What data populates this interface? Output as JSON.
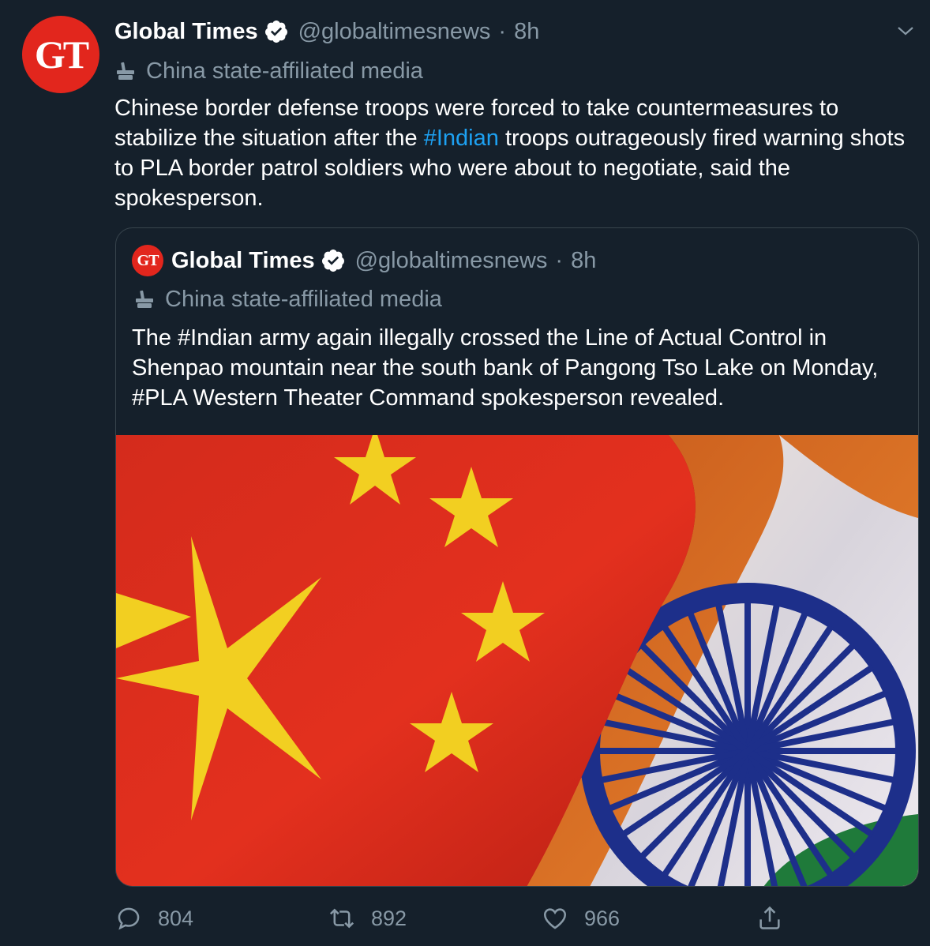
{
  "account": {
    "avatar_text": "GT",
    "name": "Global Times",
    "handle": "@globaltimesnews",
    "separator": "·",
    "time": "8h",
    "label": "China state-affiliated media"
  },
  "tweet": {
    "text_part1": "Chinese border defense troops were forced to take countermeasures to stabilize the situation after the ",
    "hashtag": "#Indian",
    "text_part2": " troops outrageously fired warning shots to PLA border patrol soldiers who were about to negotiate, said the spokesperson."
  },
  "quote": {
    "avatar_text": "GT",
    "name": "Global Times",
    "handle": "@globaltimesnews",
    "separator": "·",
    "time": "8h",
    "label": "China state-affiliated media",
    "text": "The #Indian army again illegally crossed the Line of Actual Control in Shenpao mountain near the south bank of Pangong Tso Lake on Monday, #PLA Western Theater Command spokesperson revealed."
  },
  "actions": {
    "replies": "804",
    "retweets": "892",
    "likes": "966"
  },
  "colors": {
    "background": "#15202b",
    "secondary_text": "#8899a6",
    "hashtag": "#1da1f2",
    "card_border": "#38444d",
    "gt_red": "#e2261d"
  },
  "icons": [
    "verified-badge-icon",
    "chevron-down-icon",
    "state-media-icon",
    "reply-icon",
    "retweet-icon",
    "like-icon",
    "share-icon"
  ]
}
